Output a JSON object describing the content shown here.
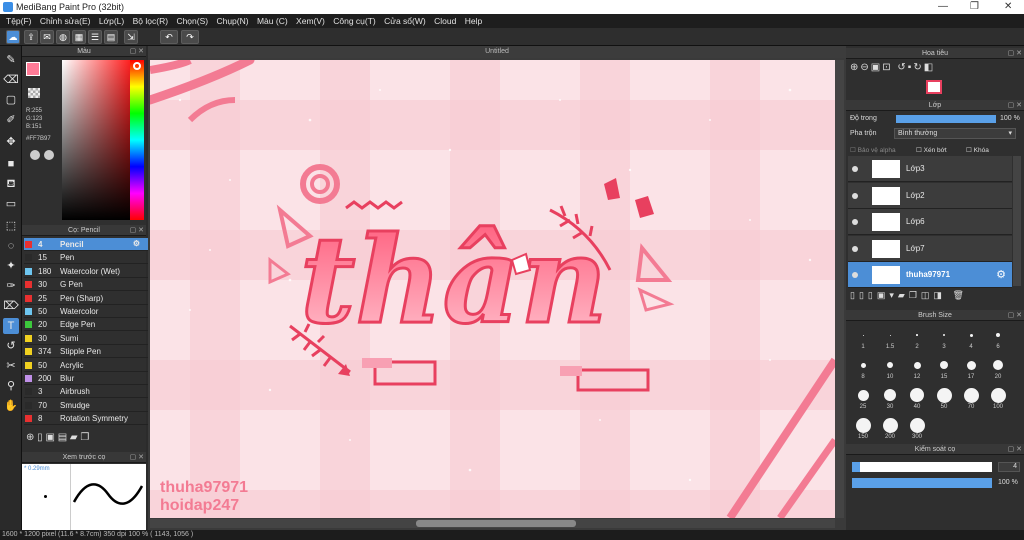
{
  "app": {
    "title": "MediBang Paint Pro (32bit)"
  },
  "menu": [
    "Tệp(F)",
    "Chỉnh sửa(E)",
    "Lớp(L)",
    "Bộ lọc(R)",
    "Chọn(S)",
    "Chụp(N)",
    "Màu (C)",
    "Xem(V)",
    "Công cụ(T)",
    "Cửa sổ(W)",
    "Cloud",
    "Help"
  ],
  "color_panel": {
    "title": "Màu",
    "r": "R:255",
    "g": "G:123",
    "b": "B:151",
    "hex": "#FF7B97",
    "primary_color": "#ff7b97"
  },
  "brush_panel": {
    "title": "Cọ: Pencil",
    "items": [
      {
        "size": "4",
        "name": "Pencil",
        "color": "#e83030"
      },
      {
        "size": "15",
        "name": "Pen",
        "color": "#2a2a2a"
      },
      {
        "size": "180",
        "name": "Watercolor (Wet)",
        "color": "#6ec6f0"
      },
      {
        "size": "30",
        "name": "G Pen",
        "color": "#e83030"
      },
      {
        "size": "25",
        "name": "Pen (Sharp)",
        "color": "#e83030"
      },
      {
        "size": "50",
        "name": "Watercolor",
        "color": "#6ec6f0"
      },
      {
        "size": "20",
        "name": "Edge Pen",
        "color": "#3cc83c"
      },
      {
        "size": "30",
        "name": "Sumi",
        "color": "#f0d020"
      },
      {
        "size": "374",
        "name": "Stipple Pen",
        "color": "#f0d020"
      },
      {
        "size": "50",
        "name": "Acrylic",
        "color": "#f0d020"
      },
      {
        "size": "200",
        "name": "Blur",
        "color": "#c090e8"
      },
      {
        "size": "3",
        "name": "Airbrush",
        "color": "#2a2a2a"
      },
      {
        "size": "70",
        "name": "Smudge",
        "color": "#2a2a2a"
      },
      {
        "size": "8",
        "name": "Rotation Symmetry",
        "color": "#e83030"
      }
    ]
  },
  "preview": {
    "title": "Xem trước cọ",
    "size": "* 0.29mm"
  },
  "canvas": {
    "tab": "Untitled",
    "artwork_text": "thân",
    "watermark1": "thuha97971",
    "watermark2": "hoidap247"
  },
  "navigator": {
    "title": "Hoa tiêu"
  },
  "layer_panel": {
    "title": "Lớp",
    "opacity_label": "Độ trong",
    "opacity_value": "100 %",
    "opacity_fraction": 1.0,
    "blend_label": "Pha trộn",
    "blend_value": "Bình thường",
    "protect_alpha": "Bảo vệ alpha",
    "clipping": "Xén bớt",
    "lock": "Khóa",
    "layers": [
      {
        "name": "Lớp3",
        "selected": false
      },
      {
        "name": "Lớp2",
        "selected": false
      },
      {
        "name": "Lớp6",
        "selected": false
      },
      {
        "name": "Lớp7",
        "selected": false
      },
      {
        "name": "thuha97971",
        "selected": true
      }
    ]
  },
  "brush_size": {
    "title": "Brush Size",
    "sizes": [
      "1",
      "1.5",
      "2",
      "3",
      "4",
      "6",
      "8",
      "10",
      "12",
      "15",
      "17",
      "20",
      "25",
      "30",
      "40",
      "50",
      "70",
      "100",
      "150",
      "200",
      "300"
    ]
  },
  "brush_control": {
    "title": "Kiểm soát cọ",
    "size_value": "4",
    "opacity_value": "100 %",
    "opacity_fraction": 1.0
  },
  "status": {
    "text": "1600 * 1200 pixel   (11.6 * 8.7cm)   350 dpi   100 %   ( 1143, 1056 )"
  },
  "colors": {
    "accent": "#4c8ed6",
    "pink": "#ff7b97"
  }
}
